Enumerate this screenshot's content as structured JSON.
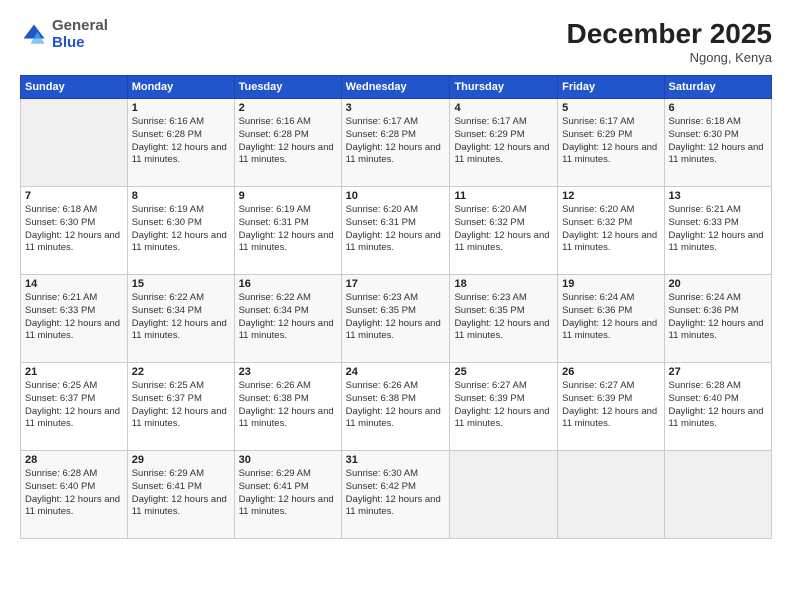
{
  "header": {
    "logo_general": "General",
    "logo_blue": "Blue",
    "month_title": "December 2025",
    "location": "Ngong, Kenya"
  },
  "days_of_week": [
    "Sunday",
    "Monday",
    "Tuesday",
    "Wednesday",
    "Thursday",
    "Friday",
    "Saturday"
  ],
  "weeks": [
    [
      {
        "day": "",
        "sunrise": "",
        "sunset": "",
        "daylight": ""
      },
      {
        "day": "1",
        "sunrise": "Sunrise: 6:16 AM",
        "sunset": "Sunset: 6:28 PM",
        "daylight": "Daylight: 12 hours and 11 minutes."
      },
      {
        "day": "2",
        "sunrise": "Sunrise: 6:16 AM",
        "sunset": "Sunset: 6:28 PM",
        "daylight": "Daylight: 12 hours and 11 minutes."
      },
      {
        "day": "3",
        "sunrise": "Sunrise: 6:17 AM",
        "sunset": "Sunset: 6:28 PM",
        "daylight": "Daylight: 12 hours and 11 minutes."
      },
      {
        "day": "4",
        "sunrise": "Sunrise: 6:17 AM",
        "sunset": "Sunset: 6:29 PM",
        "daylight": "Daylight: 12 hours and 11 minutes."
      },
      {
        "day": "5",
        "sunrise": "Sunrise: 6:17 AM",
        "sunset": "Sunset: 6:29 PM",
        "daylight": "Daylight: 12 hours and 11 minutes."
      },
      {
        "day": "6",
        "sunrise": "Sunrise: 6:18 AM",
        "sunset": "Sunset: 6:30 PM",
        "daylight": "Daylight: 12 hours and 11 minutes."
      }
    ],
    [
      {
        "day": "7",
        "sunrise": "Sunrise: 6:18 AM",
        "sunset": "Sunset: 6:30 PM",
        "daylight": "Daylight: 12 hours and 11 minutes."
      },
      {
        "day": "8",
        "sunrise": "Sunrise: 6:19 AM",
        "sunset": "Sunset: 6:30 PM",
        "daylight": "Daylight: 12 hours and 11 minutes."
      },
      {
        "day": "9",
        "sunrise": "Sunrise: 6:19 AM",
        "sunset": "Sunset: 6:31 PM",
        "daylight": "Daylight: 12 hours and 11 minutes."
      },
      {
        "day": "10",
        "sunrise": "Sunrise: 6:20 AM",
        "sunset": "Sunset: 6:31 PM",
        "daylight": "Daylight: 12 hours and 11 minutes."
      },
      {
        "day": "11",
        "sunrise": "Sunrise: 6:20 AM",
        "sunset": "Sunset: 6:32 PM",
        "daylight": "Daylight: 12 hours and 11 minutes."
      },
      {
        "day": "12",
        "sunrise": "Sunrise: 6:20 AM",
        "sunset": "Sunset: 6:32 PM",
        "daylight": "Daylight: 12 hours and 11 minutes."
      },
      {
        "day": "13",
        "sunrise": "Sunrise: 6:21 AM",
        "sunset": "Sunset: 6:33 PM",
        "daylight": "Daylight: 12 hours and 11 minutes."
      }
    ],
    [
      {
        "day": "14",
        "sunrise": "Sunrise: 6:21 AM",
        "sunset": "Sunset: 6:33 PM",
        "daylight": "Daylight: 12 hours and 11 minutes."
      },
      {
        "day": "15",
        "sunrise": "Sunrise: 6:22 AM",
        "sunset": "Sunset: 6:34 PM",
        "daylight": "Daylight: 12 hours and 11 minutes."
      },
      {
        "day": "16",
        "sunrise": "Sunrise: 6:22 AM",
        "sunset": "Sunset: 6:34 PM",
        "daylight": "Daylight: 12 hours and 11 minutes."
      },
      {
        "day": "17",
        "sunrise": "Sunrise: 6:23 AM",
        "sunset": "Sunset: 6:35 PM",
        "daylight": "Daylight: 12 hours and 11 minutes."
      },
      {
        "day": "18",
        "sunrise": "Sunrise: 6:23 AM",
        "sunset": "Sunset: 6:35 PM",
        "daylight": "Daylight: 12 hours and 11 minutes."
      },
      {
        "day": "19",
        "sunrise": "Sunrise: 6:24 AM",
        "sunset": "Sunset: 6:36 PM",
        "daylight": "Daylight: 12 hours and 11 minutes."
      },
      {
        "day": "20",
        "sunrise": "Sunrise: 6:24 AM",
        "sunset": "Sunset: 6:36 PM",
        "daylight": "Daylight: 12 hours and 11 minutes."
      }
    ],
    [
      {
        "day": "21",
        "sunrise": "Sunrise: 6:25 AM",
        "sunset": "Sunset: 6:37 PM",
        "daylight": "Daylight: 12 hours and 11 minutes."
      },
      {
        "day": "22",
        "sunrise": "Sunrise: 6:25 AM",
        "sunset": "Sunset: 6:37 PM",
        "daylight": "Daylight: 12 hours and 11 minutes."
      },
      {
        "day": "23",
        "sunrise": "Sunrise: 6:26 AM",
        "sunset": "Sunset: 6:38 PM",
        "daylight": "Daylight: 12 hours and 11 minutes."
      },
      {
        "day": "24",
        "sunrise": "Sunrise: 6:26 AM",
        "sunset": "Sunset: 6:38 PM",
        "daylight": "Daylight: 12 hours and 11 minutes."
      },
      {
        "day": "25",
        "sunrise": "Sunrise: 6:27 AM",
        "sunset": "Sunset: 6:39 PM",
        "daylight": "Daylight: 12 hours and 11 minutes."
      },
      {
        "day": "26",
        "sunrise": "Sunrise: 6:27 AM",
        "sunset": "Sunset: 6:39 PM",
        "daylight": "Daylight: 12 hours and 11 minutes."
      },
      {
        "day": "27",
        "sunrise": "Sunrise: 6:28 AM",
        "sunset": "Sunset: 6:40 PM",
        "daylight": "Daylight: 12 hours and 11 minutes."
      }
    ],
    [
      {
        "day": "28",
        "sunrise": "Sunrise: 6:28 AM",
        "sunset": "Sunset: 6:40 PM",
        "daylight": "Daylight: 12 hours and 11 minutes."
      },
      {
        "day": "29",
        "sunrise": "Sunrise: 6:29 AM",
        "sunset": "Sunset: 6:41 PM",
        "daylight": "Daylight: 12 hours and 11 minutes."
      },
      {
        "day": "30",
        "sunrise": "Sunrise: 6:29 AM",
        "sunset": "Sunset: 6:41 PM",
        "daylight": "Daylight: 12 hours and 11 minutes."
      },
      {
        "day": "31",
        "sunrise": "Sunrise: 6:30 AM",
        "sunset": "Sunset: 6:42 PM",
        "daylight": "Daylight: 12 hours and 11 minutes."
      },
      {
        "day": "",
        "sunrise": "",
        "sunset": "",
        "daylight": ""
      },
      {
        "day": "",
        "sunrise": "",
        "sunset": "",
        "daylight": ""
      },
      {
        "day": "",
        "sunrise": "",
        "sunset": "",
        "daylight": ""
      }
    ]
  ]
}
